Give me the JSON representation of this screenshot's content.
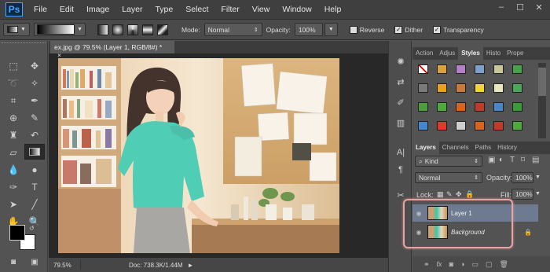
{
  "app": {
    "logo": "Ps"
  },
  "menu": [
    "File",
    "Edit",
    "Image",
    "Layer",
    "Type",
    "Select",
    "Filter",
    "View",
    "Window",
    "Help"
  ],
  "window_controls": [
    "–",
    "☐",
    "✕"
  ],
  "options_bar": {
    "mode_label": "Mode:",
    "mode_value": "Normal",
    "opacity_label": "Opacity:",
    "opacity_value": "100%",
    "reverse_label": "Reverse",
    "dither_label": "Dither",
    "transparency_label": "Transparency",
    "dither_checked": true,
    "transparency_checked": true,
    "reverse_checked": false
  },
  "document": {
    "tab_title": "ex.jpg @ 79.5% (Layer 1, RGB/8#) *",
    "tab_close": "×",
    "zoom": "79.5%",
    "doc_info": "Doc: 738.3K/1.44M"
  },
  "swatches_panel": {
    "tabs": [
      "Action",
      "Adjus",
      "Styles",
      "Histo",
      "Prope"
    ],
    "active_tab": "Styles",
    "rows": [
      [
        "#ffffff",
        "#d9a23a",
        "#b67fc9",
        "#7fa0c9",
        "#c9c59a",
        "#49a14a"
      ],
      [
        "#7a7a7a",
        "#e8a21d",
        "#c77a3c",
        "#f1d438",
        "#e9e6c0",
        "#4da75a"
      ],
      [
        "#4c9e3b",
        "#4fa83e",
        "#d8641e",
        "#c03a2b",
        "#4a86c8",
        "#3b9a3b"
      ],
      [
        "#4688d0",
        "#dd3a2e",
        "#cfcfcf",
        "#d8641e",
        "#c03a2b",
        "#4fa83e"
      ]
    ]
  },
  "layers_panel": {
    "tabs": [
      "Layers",
      "Channels",
      "Paths",
      "History"
    ],
    "active_tab": "Layers",
    "filter_label": "Kind",
    "blend_mode": "Normal",
    "opacity_label": "Opacity:",
    "opacity_value": "100%",
    "lock_label": "Lock:",
    "fill_label": "Fill:",
    "fill_value": "100%",
    "layers": [
      {
        "name": "Layer 1",
        "selected": true,
        "locked": false
      },
      {
        "name": "Background",
        "selected": false,
        "locked": true
      }
    ]
  },
  "colors": {
    "foreground": "#000000",
    "background": "#ffffff",
    "accent": "#4da3ff",
    "highlight": "#e8a3a3"
  }
}
